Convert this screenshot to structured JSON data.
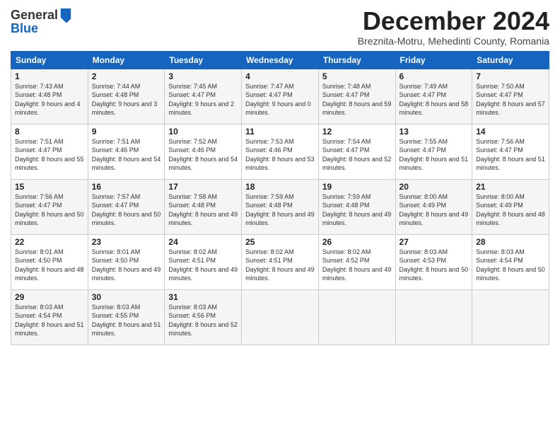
{
  "header": {
    "logo_general": "General",
    "logo_blue": "Blue",
    "title": "December 2024",
    "subtitle": "Breznita-Motru, Mehedinti County, Romania"
  },
  "columns": [
    "Sunday",
    "Monday",
    "Tuesday",
    "Wednesday",
    "Thursday",
    "Friday",
    "Saturday"
  ],
  "weeks": [
    [
      {
        "day": "1",
        "sunrise": "7:43 AM",
        "sunset": "4:48 PM",
        "daylight": "9 hours and 4 minutes."
      },
      {
        "day": "2",
        "sunrise": "7:44 AM",
        "sunset": "4:48 PM",
        "daylight": "9 hours and 3 minutes."
      },
      {
        "day": "3",
        "sunrise": "7:45 AM",
        "sunset": "4:47 PM",
        "daylight": "9 hours and 2 minutes."
      },
      {
        "day": "4",
        "sunrise": "7:47 AM",
        "sunset": "4:47 PM",
        "daylight": "9 hours and 0 minutes."
      },
      {
        "day": "5",
        "sunrise": "7:48 AM",
        "sunset": "4:47 PM",
        "daylight": "8 hours and 59 minutes."
      },
      {
        "day": "6",
        "sunrise": "7:49 AM",
        "sunset": "4:47 PM",
        "daylight": "8 hours and 58 minutes."
      },
      {
        "day": "7",
        "sunrise": "7:50 AM",
        "sunset": "4:47 PM",
        "daylight": "8 hours and 57 minutes."
      }
    ],
    [
      {
        "day": "8",
        "sunrise": "7:51 AM",
        "sunset": "4:47 PM",
        "daylight": "8 hours and 55 minutes."
      },
      {
        "day": "9",
        "sunrise": "7:51 AM",
        "sunset": "4:46 PM",
        "daylight": "8 hours and 54 minutes."
      },
      {
        "day": "10",
        "sunrise": "7:52 AM",
        "sunset": "4:46 PM",
        "daylight": "8 hours and 54 minutes."
      },
      {
        "day": "11",
        "sunrise": "7:53 AM",
        "sunset": "4:46 PM",
        "daylight": "8 hours and 53 minutes."
      },
      {
        "day": "12",
        "sunrise": "7:54 AM",
        "sunset": "4:47 PM",
        "daylight": "8 hours and 52 minutes."
      },
      {
        "day": "13",
        "sunrise": "7:55 AM",
        "sunset": "4:47 PM",
        "daylight": "8 hours and 51 minutes."
      },
      {
        "day": "14",
        "sunrise": "7:56 AM",
        "sunset": "4:47 PM",
        "daylight": "8 hours and 51 minutes."
      }
    ],
    [
      {
        "day": "15",
        "sunrise": "7:56 AM",
        "sunset": "4:47 PM",
        "daylight": "8 hours and 50 minutes."
      },
      {
        "day": "16",
        "sunrise": "7:57 AM",
        "sunset": "4:47 PM",
        "daylight": "8 hours and 50 minutes."
      },
      {
        "day": "17",
        "sunrise": "7:58 AM",
        "sunset": "4:48 PM",
        "daylight": "8 hours and 49 minutes."
      },
      {
        "day": "18",
        "sunrise": "7:59 AM",
        "sunset": "4:48 PM",
        "daylight": "8 hours and 49 minutes."
      },
      {
        "day": "19",
        "sunrise": "7:59 AM",
        "sunset": "4:48 PM",
        "daylight": "8 hours and 49 minutes."
      },
      {
        "day": "20",
        "sunrise": "8:00 AM",
        "sunset": "4:49 PM",
        "daylight": "8 hours and 49 minutes."
      },
      {
        "day": "21",
        "sunrise": "8:00 AM",
        "sunset": "4:49 PM",
        "daylight": "8 hours and 48 minutes."
      }
    ],
    [
      {
        "day": "22",
        "sunrise": "8:01 AM",
        "sunset": "4:50 PM",
        "daylight": "8 hours and 48 minutes."
      },
      {
        "day": "23",
        "sunrise": "8:01 AM",
        "sunset": "4:50 PM",
        "daylight": "8 hours and 49 minutes."
      },
      {
        "day": "24",
        "sunrise": "8:02 AM",
        "sunset": "4:51 PM",
        "daylight": "8 hours and 49 minutes."
      },
      {
        "day": "25",
        "sunrise": "8:02 AM",
        "sunset": "4:51 PM",
        "daylight": "8 hours and 49 minutes."
      },
      {
        "day": "26",
        "sunrise": "8:02 AM",
        "sunset": "4:52 PM",
        "daylight": "8 hours and 49 minutes."
      },
      {
        "day": "27",
        "sunrise": "8:03 AM",
        "sunset": "4:53 PM",
        "daylight": "8 hours and 50 minutes."
      },
      {
        "day": "28",
        "sunrise": "8:03 AM",
        "sunset": "4:54 PM",
        "daylight": "8 hours and 50 minutes."
      }
    ],
    [
      {
        "day": "29",
        "sunrise": "8:03 AM",
        "sunset": "4:54 PM",
        "daylight": "8 hours and 51 minutes."
      },
      {
        "day": "30",
        "sunrise": "8:03 AM",
        "sunset": "4:55 PM",
        "daylight": "8 hours and 51 minutes."
      },
      {
        "day": "31",
        "sunrise": "8:03 AM",
        "sunset": "4:56 PM",
        "daylight": "8 hours and 52 minutes."
      },
      null,
      null,
      null,
      null
    ]
  ]
}
